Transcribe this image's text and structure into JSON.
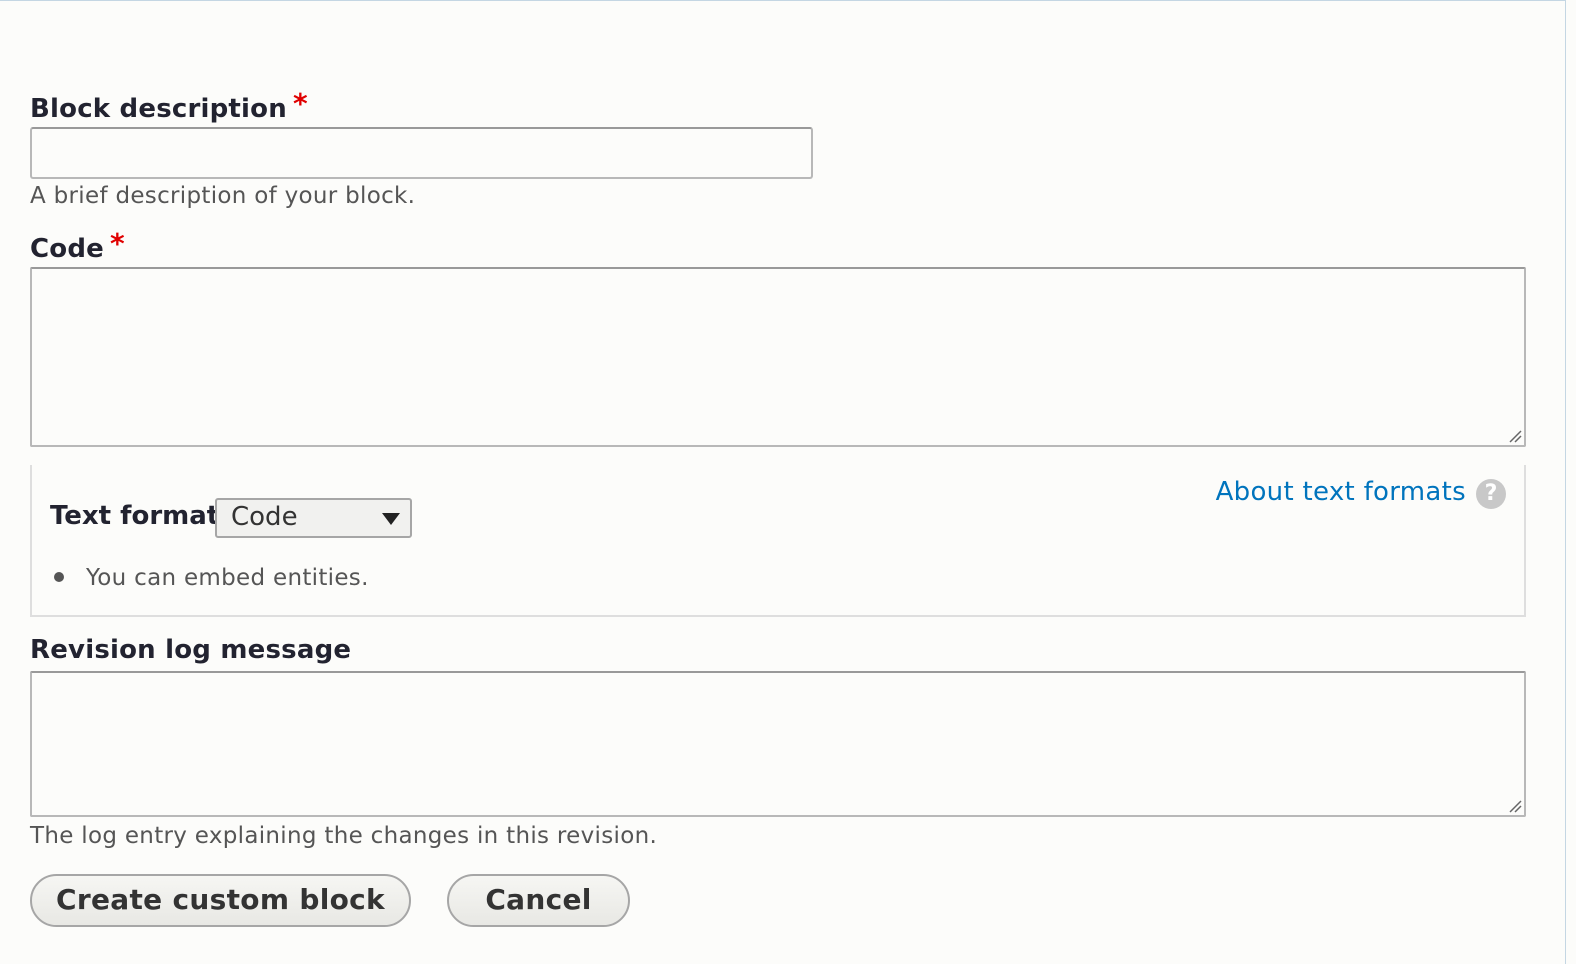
{
  "form": {
    "block_description": {
      "label": "Block description",
      "required_marker": "*",
      "value": "",
      "description": "A brief description of your block."
    },
    "code": {
      "label": "Code",
      "required_marker": "*",
      "value": ""
    },
    "text_format": {
      "label": "Text format",
      "selected": "Code",
      "about_link": "About text formats",
      "help_icon": "?",
      "tips": [
        "You can embed entities."
      ]
    },
    "revision_log": {
      "label": "Revision log message",
      "value": "",
      "description": "The log entry explaining the changes in this revision."
    },
    "actions": {
      "submit_label": "Create custom block",
      "cancel_label": "Cancel"
    }
  },
  "colors": {
    "required": "#e00000",
    "link": "#0074bd",
    "background": "#fcfcfa"
  }
}
